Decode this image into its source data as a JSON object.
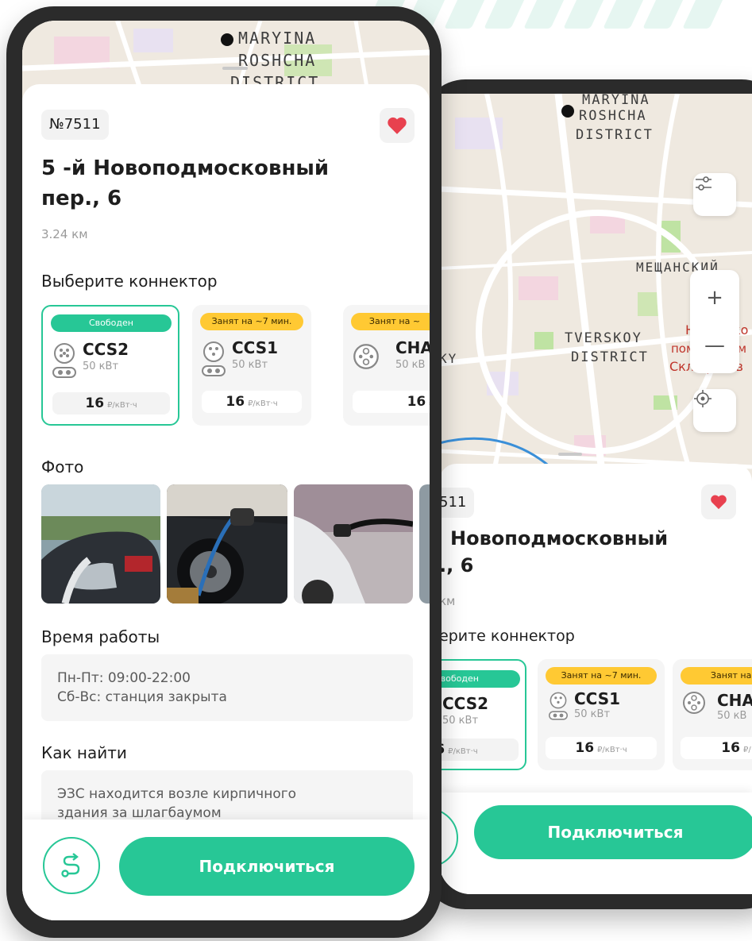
{
  "colors": {
    "accent": "#27c796",
    "busy": "#ffc933",
    "heart": "#e8414f"
  },
  "map": {
    "district_top": [
      "MARYINA",
      "ROSHCHA",
      "DISTRICT"
    ],
    "district_mid": [
      "TVERSKOY",
      "DISTRICT"
    ],
    "label_mesh": "МЕЩАНСКИЙ",
    "label_n": "Н",
    "label_ko": "ко",
    "label_pom": "пом",
    "label_im": "им",
    "label_sklif": "Склифосов",
    "label_ky": "KY"
  },
  "station": {
    "number": "№7511",
    "title_line1": "5 -й Новоподмосковный",
    "title_line2": "пер., 6",
    "distance": "3.24 км"
  },
  "sections": {
    "connector": "Выберите коннектор",
    "photo": "Фото",
    "hours": "Время работы",
    "find": "Как найти"
  },
  "connectors": [
    {
      "status": "Свободен",
      "name": "CCS2",
      "power": "50 кВт",
      "price": "16",
      "unit": "₽/кВт·ч"
    },
    {
      "status": "Занят на ~7 мин.",
      "name": "CCS1",
      "power": "50 кВт",
      "price": "16",
      "unit": "₽/кВт·ч"
    },
    {
      "status": "Занят на ~",
      "name": "CHA",
      "power": "50 кВ",
      "price": "16",
      "unit": "₽/"
    }
  ],
  "hours": {
    "line1": "Пн-Пт: 09:00-22:00",
    "line2": "Сб-Вс: станция закрыта"
  },
  "find": {
    "line1": "ЭЗС находится возле кирпичного",
    "line2": "здания за шлагбаумом"
  },
  "actions": {
    "connect": "Подключиться"
  },
  "back": {
    "number": "511",
    "title_line1": "Новоподмосковный",
    "title_line2": "., 6",
    "distance": "км",
    "connector": "ерите коннектор",
    "connectors": [
      {
        "status": "Свободен",
        "name": "CCS2",
        "power": "50 кВт",
        "price": "6",
        "unit": "₽/кВт·ч"
      },
      {
        "status": "Занят на ~7 мин.",
        "name": "CCS1",
        "power": "50 кВт",
        "price": "16",
        "unit": "₽/кВт·ч"
      },
      {
        "status": "Занят на ~",
        "name": "CHA",
        "power": "50 кВ",
        "price": "16",
        "unit": "₽/"
      }
    ]
  }
}
